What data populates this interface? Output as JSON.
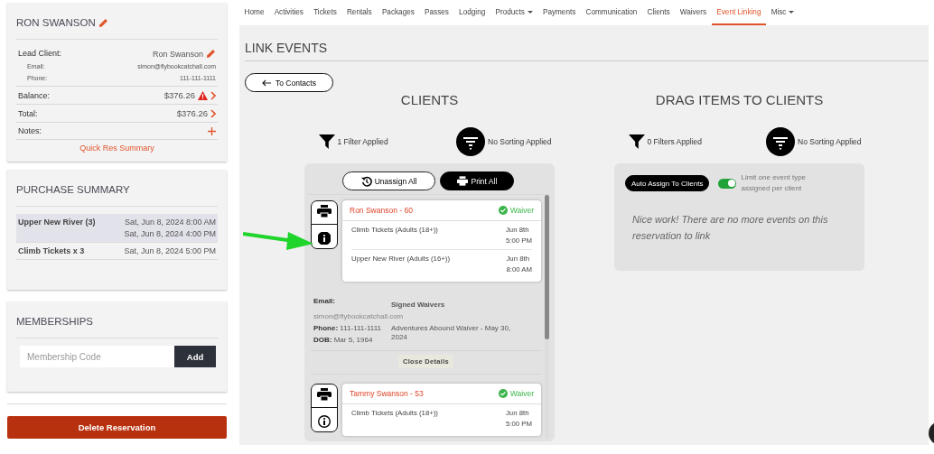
{
  "reservation": {
    "title": "RON SWANSON",
    "lead_label": "Lead Client:",
    "lead_name": "Ron Swanson",
    "email_label": "Email:",
    "email": "simon@flybookcatchall.com",
    "phone_label": "Phone:",
    "phone": "111-111-1111",
    "rows": [
      {
        "label": "Balance:",
        "value": "$376.26",
        "warning": true,
        "kind": "link"
      },
      {
        "label": "Total:",
        "value": "$376.26",
        "warning": false,
        "kind": "link"
      },
      {
        "label": "Notes:",
        "value": "",
        "warning": false,
        "kind": "add"
      }
    ],
    "summary_link": "Quick Res Summary"
  },
  "purchase_summary": {
    "title": "PURCHASE SUMMARY",
    "items": [
      {
        "name": "Upper New River (3)",
        "dates": [
          "Sat, Jun 8, 2024 8:00 AM",
          "Sat, Jun 8, 2024 4:00 PM"
        ],
        "selected": true
      },
      {
        "name": "Climb Tickets x 3",
        "dates": [
          "Sat, Jun 8, 2024 5:00 PM"
        ],
        "selected": false
      }
    ]
  },
  "memberships": {
    "title": "MEMBERSHIPS",
    "placeholder": "Membership Code",
    "button": "Add"
  },
  "delete_button": "Delete Reservation",
  "nav": [
    {
      "label": "Home",
      "selected": false,
      "has_menu": false
    },
    {
      "label": "Activities",
      "selected": false,
      "has_menu": false
    },
    {
      "label": "Tickets",
      "selected": false,
      "has_menu": false
    },
    {
      "label": "Rentals",
      "selected": false,
      "has_menu": false
    },
    {
      "label": "Packages",
      "selected": false,
      "has_menu": false
    },
    {
      "label": "Passes",
      "selected": false,
      "has_menu": false
    },
    {
      "label": "Lodging",
      "selected": false,
      "has_menu": false
    },
    {
      "label": "Products",
      "selected": false,
      "has_menu": true
    },
    {
      "label": "Payments",
      "selected": false,
      "has_menu": false
    },
    {
      "label": "Communication",
      "selected": false,
      "has_menu": false
    },
    {
      "label": "Clients",
      "selected": false,
      "has_menu": false
    },
    {
      "label": "Waivers",
      "selected": false,
      "has_menu": false
    },
    {
      "label": "Event Linking",
      "selected": true,
      "has_menu": false
    },
    {
      "label": "Misc",
      "selected": false,
      "has_menu": true
    }
  ],
  "page_title": "LINK EVENTS",
  "back_button": "To Contacts",
  "clients": {
    "title": "CLIENTS",
    "filter": "1 Filter Applied",
    "sorting": "No Sorting Applied",
    "unassign_button": "Unassign All",
    "print_button": "Print All",
    "list": [
      {
        "name": "Ron Swanson - 60",
        "waiver": "Waiver",
        "waiver_signed": true,
        "expanded": true,
        "events": [
          {
            "name": "Climb Tickets (Adults (18+))",
            "date": "Jun 8th",
            "time": "5:00 PM"
          },
          {
            "name": "Upper New River (Adults (16+))",
            "date": "Jun 8th",
            "time": "8:00 AM"
          }
        ],
        "details": {
          "email_label": "Email:",
          "email": "simon@flybookcatchall.com",
          "phone_label": "Phone:",
          "phone": "111-111-1111",
          "dob_label": "DOB:",
          "dob": "Mar 5, 1964",
          "waivers_title": "Signed Waivers",
          "waivers": [
            "Adventures Abound Waiver - May 30, 2024"
          ],
          "close_button": "Close Details"
        }
      },
      {
        "name": "Tammy Swanson - 53",
        "waiver": "Waiver",
        "waiver_signed": true,
        "expanded": false,
        "events": [
          {
            "name": "Climb Tickets (Adults (18+))",
            "date": "Jun 8th",
            "time": "5:00 PM"
          }
        ]
      }
    ]
  },
  "items": {
    "title": "DRAG ITEMS TO CLIENTS",
    "filter": "0 Filters Applied",
    "sorting": "No Sorting Applied",
    "auto_assign_button": "Auto Assign To Clients",
    "limit_toggle": {
      "label": "Limit one event type assigned per client",
      "on": true
    },
    "empty_message": "Nice work! There are no more events on this reservation to link"
  }
}
